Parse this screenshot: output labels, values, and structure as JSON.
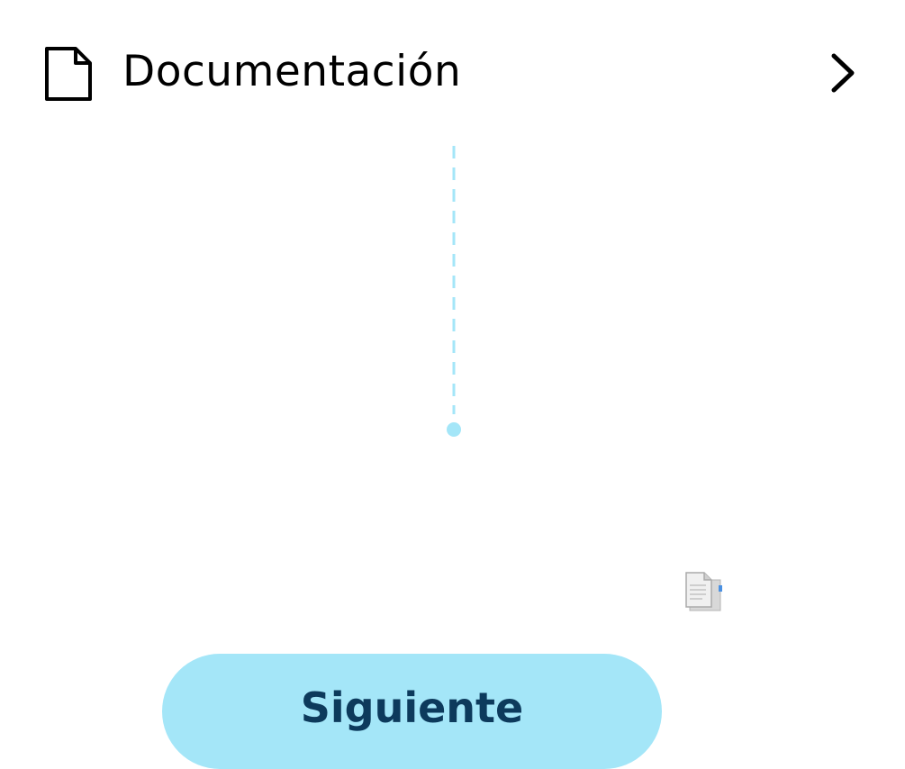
{
  "documentation_row": {
    "label": "Documentación",
    "icon": "document-icon",
    "chevron_icon": "chevron-right-icon"
  },
  "connector": {
    "color": "#a4e6f8"
  },
  "drag_icon": "document-copy-icon",
  "next_button": {
    "label": "Siguiente",
    "background": "#a4e6f8",
    "text_color": "#0d3a5c"
  }
}
